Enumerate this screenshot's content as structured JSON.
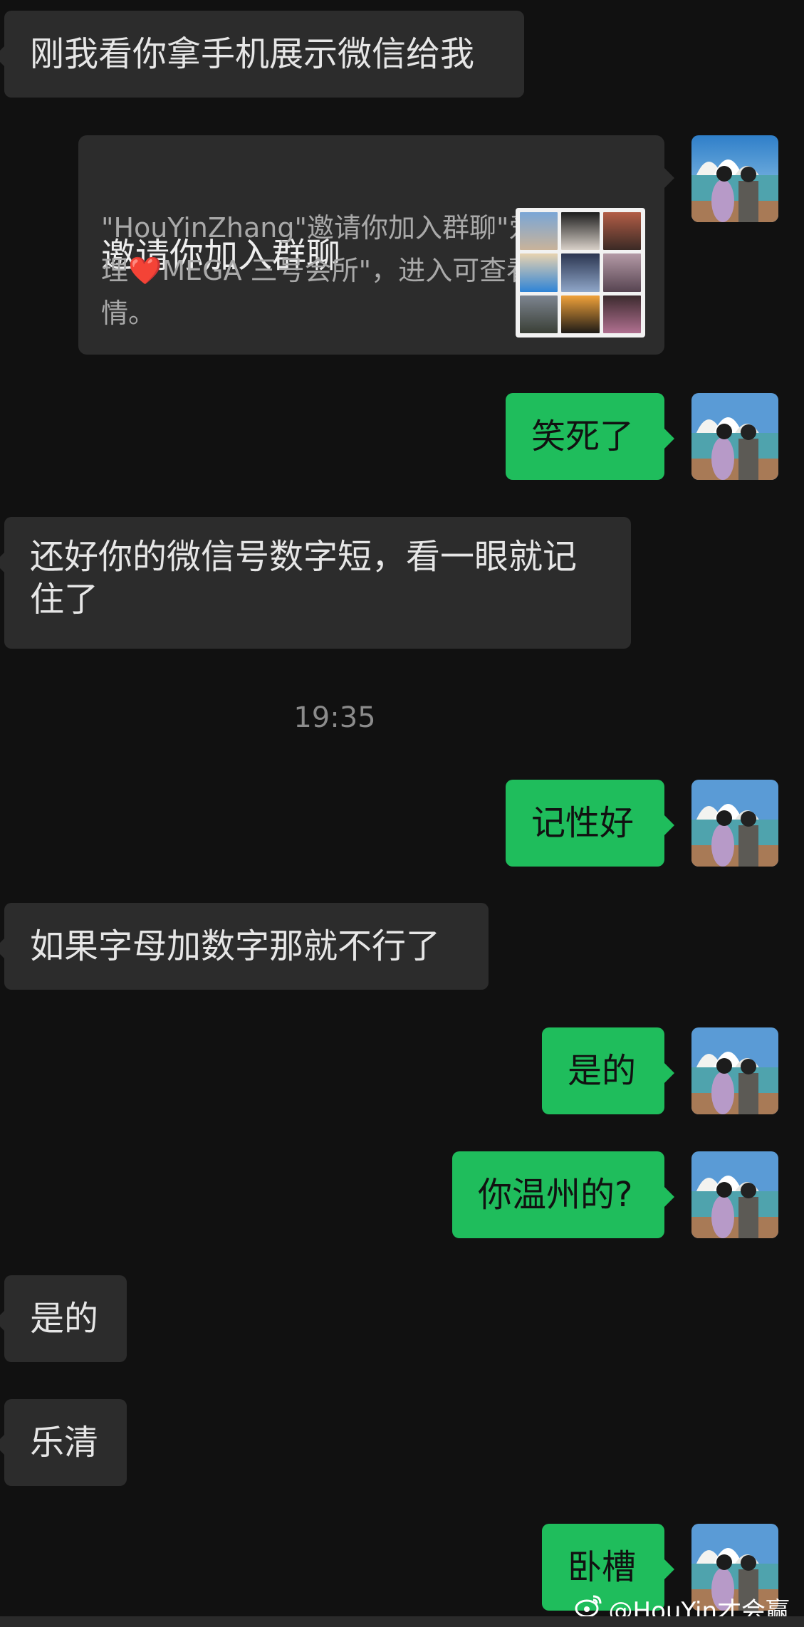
{
  "messages": {
    "m1": "刚我看你拿手机展示微信给我",
    "card": {
      "title": "邀请你加入群聊",
      "desc_part1": "\"HouYinZhang\"邀请你加入群聊\"爱着理",
      "heart": "❤️",
      "desc_part2": "MEGA 三号会所\"，进入可查看详情。"
    },
    "m2": "笑死了",
    "m3": "还好你的微信号数字短，看一眼就记住了",
    "time": "19:35",
    "m4": "记性好",
    "m5": "如果字母加数字那就不行了",
    "m6": "是的",
    "m7": "你温州的?",
    "m8": "是的",
    "m9": "乐清",
    "m10": "卧槽"
  },
  "watermark": {
    "icon": "weibo-icon",
    "text": "@HouYin才会赢"
  },
  "colors": {
    "background": "#111111",
    "incoming_bubble": "#2c2c2c",
    "outgoing_bubble": "#1fbd5c",
    "time_text": "#8b8b8b"
  }
}
